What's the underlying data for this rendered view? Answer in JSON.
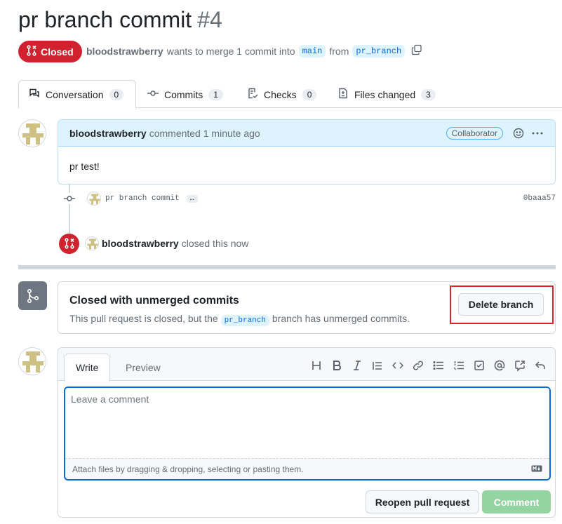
{
  "pr": {
    "title": "pr branch commit",
    "number": "#4",
    "state": "Closed",
    "author": "bloodstrawberry",
    "meta_text_1": "wants to merge 1 commit into",
    "base_branch": "main",
    "meta_text_2": "from",
    "head_branch": "pr_branch"
  },
  "tabs": [
    {
      "label": "Conversation",
      "count": "0"
    },
    {
      "label": "Commits",
      "count": "1"
    },
    {
      "label": "Checks",
      "count": "0"
    },
    {
      "label": "Files changed",
      "count": "3"
    }
  ],
  "comment": {
    "author": "bloodstrawberry",
    "action": "commented",
    "time": "1 minute ago",
    "role": "Collaborator",
    "body": "pr test!"
  },
  "commit_event": {
    "message": "pr branch commit",
    "ellipsis": "…",
    "sha": "0baaa57"
  },
  "closed_event": {
    "author": "bloodstrawberry",
    "text": "closed this now"
  },
  "merge_box": {
    "title": "Closed with unmerged commits",
    "desc_1": "This pull request is closed, but the",
    "branch": "pr_branch",
    "desc_2": "branch has unmerged commits.",
    "delete_button": "Delete branch"
  },
  "editor": {
    "tab_write": "Write",
    "tab_preview": "Preview",
    "placeholder": "Leave a comment",
    "attach_hint": "Attach files by dragging & dropping, selecting or pasting them.",
    "reopen_button": "Reopen pull request",
    "comment_button": "Comment",
    "toolbar_icons": [
      "heading-icon",
      "bold-icon",
      "italic-icon",
      "quote-icon",
      "code-icon",
      "link-icon",
      "unordered-list-icon",
      "ordered-list-icon",
      "task-list-icon",
      "mention-icon",
      "reference-icon",
      "reply-icon"
    ]
  },
  "colors": {
    "closed_red": "#cf222e",
    "accent_blue": "#0969da",
    "comment_green_disabled": "#94d3a2",
    "highlight_red": "#e0202a"
  }
}
